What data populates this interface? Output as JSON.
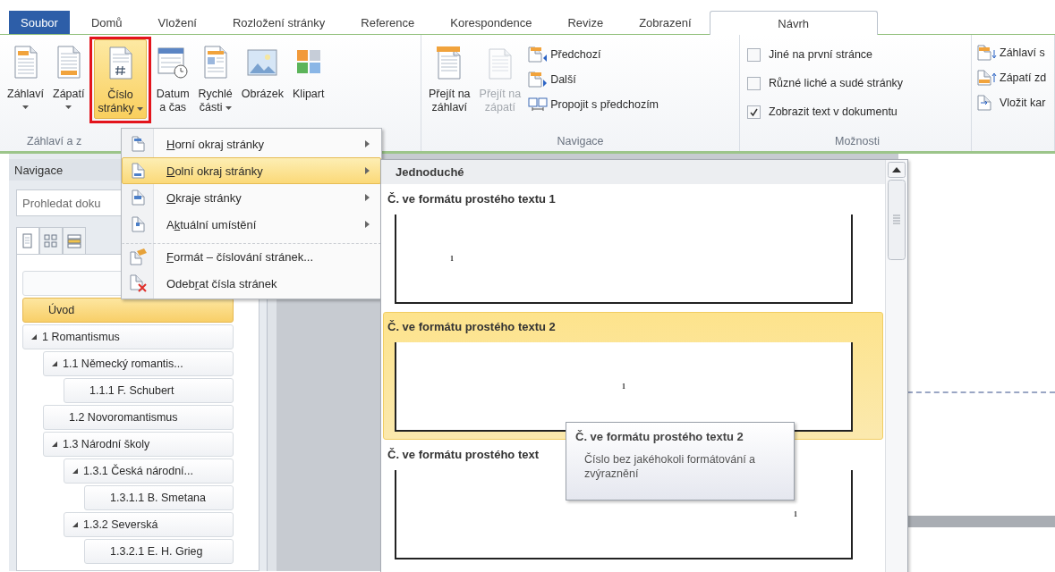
{
  "tabs": [
    {
      "label": "Soubor",
      "kind": "file",
      "selected": false
    },
    {
      "label": "Domů",
      "kind": "tab",
      "selected": false
    },
    {
      "label": "Vložení",
      "kind": "tab",
      "selected": false
    },
    {
      "label": "Rozložení stránky",
      "kind": "tab",
      "selected": false
    },
    {
      "label": "Reference",
      "kind": "tab",
      "selected": false
    },
    {
      "label": "Korespondence",
      "kind": "tab",
      "selected": false
    },
    {
      "label": "Revize",
      "kind": "tab",
      "selected": false
    },
    {
      "label": "Zobrazení",
      "kind": "tab",
      "selected": false
    },
    {
      "label": "Návrh",
      "kind": "contextual",
      "selected": true
    }
  ],
  "ribbon": {
    "groups": [
      {
        "label": "Záhlaví a z",
        "items": [
          {
            "kind": "large",
            "label_lines": [
              "Záhlaví"
            ],
            "dropdown": true,
            "active": false,
            "disabled": false
          },
          {
            "kind": "large",
            "label_lines": [
              "Zápatí"
            ],
            "dropdown": true,
            "active": false,
            "disabled": false
          },
          {
            "kind": "large",
            "label_lines": [
              "Číslo",
              "stránky"
            ],
            "dropdown": true,
            "active": true,
            "highlighted": true,
            "disabled": false
          },
          {
            "kind": "large",
            "label_lines": [
              "Datum",
              "a čas"
            ],
            "dropdown": false,
            "active": false,
            "disabled": false
          },
          {
            "kind": "large",
            "label_lines": [
              "Rychlé",
              "části"
            ],
            "dropdown": true,
            "active": false,
            "disabled": false
          },
          {
            "kind": "large",
            "label_lines": [
              "Obrázek"
            ],
            "dropdown": false,
            "active": false,
            "disabled": false
          },
          {
            "kind": "large",
            "label_lines": [
              "Klipart"
            ],
            "dropdown": false,
            "active": false,
            "disabled": false
          }
        ]
      },
      {
        "label": "Navigace",
        "items": [
          {
            "kind": "large",
            "label_lines": [
              "Přejít na",
              "záhlaví"
            ],
            "dropdown": false,
            "active": false,
            "disabled": false
          },
          {
            "kind": "large",
            "label_lines": [
              "Přejít na",
              "zápatí"
            ],
            "dropdown": false,
            "active": false,
            "disabled": true
          },
          {
            "kind": "small",
            "label": "Předchozí",
            "disabled": false
          },
          {
            "kind": "small",
            "label": "Další",
            "disabled": false
          },
          {
            "kind": "small",
            "label": "Propojit s předchozím",
            "disabled": false
          }
        ]
      },
      {
        "label": "Možnosti",
        "items": [
          {
            "kind": "checkbox",
            "label": "Jiné na první stránce",
            "checked": false
          },
          {
            "kind": "checkbox",
            "label": "Různé liché a sudé stránky",
            "checked": false
          },
          {
            "kind": "checkbox",
            "label": "Zobrazit text v dokumentu",
            "checked": true
          }
        ]
      },
      {
        "items": [
          {
            "kind": "small",
            "label": "Záhlaví s",
            "disabled": false
          },
          {
            "kind": "small",
            "label": "Zápatí zd",
            "disabled": false
          },
          {
            "kind": "small",
            "label": "Vložit kar",
            "disabled": false
          }
        ]
      }
    ]
  },
  "navigation": {
    "title": "Navigace",
    "search": {
      "placeholder": "Prohledat doku"
    },
    "view_tabs": [
      {
        "selected": true
      },
      {
        "selected": false
      },
      {
        "selected": false
      }
    ],
    "tree": [
      {
        "label": "Úvod",
        "selected": true
      },
      {
        "label": "1 Romantismus",
        "selected": false,
        "expanded": true,
        "children": [
          {
            "label": "1.1 Německý romantis...",
            "selected": false,
            "expanded": true,
            "children": [
              {
                "label": "1.1.1 F. Schubert",
                "selected": false
              }
            ]
          },
          {
            "label": "1.2 Novoromantismus",
            "selected": false
          },
          {
            "label": "1.3 Národní školy",
            "selected": false,
            "expanded": true,
            "children": [
              {
                "label": "1.3.1 Česká národní...",
                "selected": false,
                "expanded": true,
                "children": [
                  {
                    "label": "1.3.1.1 B. Smetana",
                    "selected": false
                  }
                ]
              },
              {
                "label": "1.3.2 Severská",
                "selected": false,
                "expanded": true,
                "children": [
                  {
                    "label": "1.3.2.1 E. H. Grieg",
                    "selected": false
                  }
                ]
              }
            ]
          }
        ]
      }
    ]
  },
  "menu": {
    "items": [
      {
        "access_key": "H",
        "label_end": "orní okraj stránky",
        "kind": "submenu",
        "highlighted": false,
        "separator_before": false
      },
      {
        "access_key": "D",
        "label_end": "olní okraj stránky",
        "kind": "submenu",
        "highlighted": true,
        "separator_before": false
      },
      {
        "access_key": "O",
        "label_end": "kraje stránky",
        "kind": "submenu",
        "highlighted": false,
        "separator_before": false
      },
      {
        "label_start": "A",
        "access_key": "k",
        "label_end": "tuální umístění",
        "kind": "submenu",
        "highlighted": false,
        "separator_before": false
      },
      {
        "access_key": "F",
        "label_end": "ormát – číslování stránek...",
        "kind": "command",
        "highlighted": false,
        "separator_before": true
      },
      {
        "label_start": "Odeb",
        "access_key": "r",
        "label_end": "at čísla stránek",
        "kind": "command",
        "highlighted": false,
        "separator_before": false
      }
    ]
  },
  "gallery": {
    "heading": "Jednoduché",
    "items": [
      {
        "title": "Č. ve formátu prostého textu 1",
        "number": "1",
        "kind": "left",
        "selected": false
      },
      {
        "title": "Č. ve formátu prostého textu 2",
        "number": "1",
        "kind": "center",
        "selected": true
      },
      {
        "title": "Č. ve formátu prostého text",
        "number": "1",
        "kind": "right",
        "selected": false
      }
    ]
  },
  "tooltip": {
    "title": "Č. ve formátu prostého textu 2",
    "description": "Číslo bez jakéhokoli formátování a zvýraznění"
  }
}
